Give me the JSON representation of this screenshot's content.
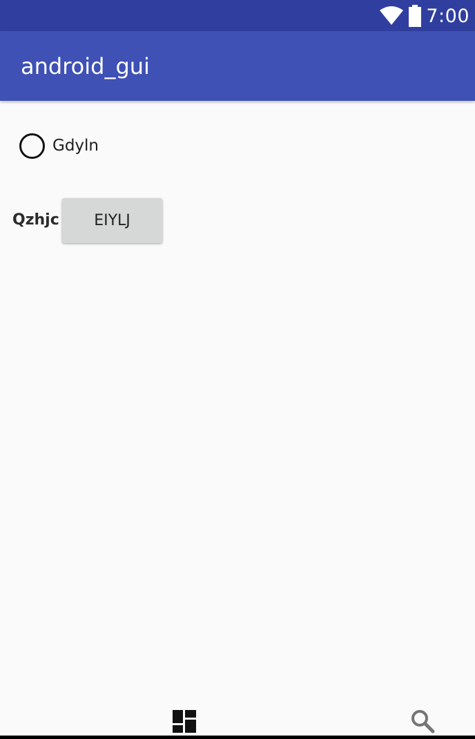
{
  "status_bar": {
    "time": "7:00",
    "icons": [
      "wifi-icon",
      "battery-icon"
    ],
    "color": "#303f9f"
  },
  "app_bar": {
    "title": "android_gui",
    "color": "#3f51b5"
  },
  "radio_option": {
    "label": "Gdyln",
    "checked": false
  },
  "form_row": {
    "label": "Qzhjc",
    "button_label": "EIYLJ"
  },
  "bottom_bar": {
    "icons": [
      "dashboard-icon",
      "search-icon"
    ]
  }
}
